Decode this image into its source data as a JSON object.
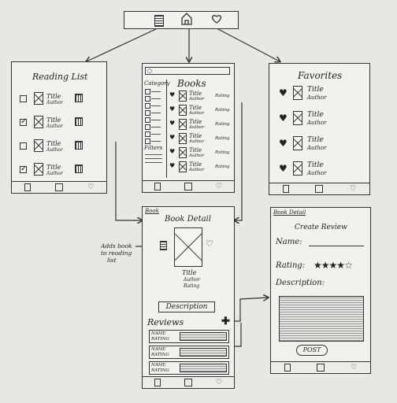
{
  "reading_list": {
    "title": "Reading List",
    "items": [
      {
        "title": "Title",
        "author": "Author",
        "checked": false
      },
      {
        "title": "Title",
        "author": "Author",
        "checked": true
      },
      {
        "title": "Title",
        "author": "Author",
        "checked": false
      },
      {
        "title": "Title",
        "author": "Author",
        "checked": true
      }
    ]
  },
  "books": {
    "title": "Books",
    "category_label": "Category",
    "filters_label": "Filters",
    "items": [
      {
        "title": "Title",
        "author": "Author",
        "rating": "Rating"
      },
      {
        "title": "Title",
        "author": "Author",
        "rating": "Rating"
      },
      {
        "title": "Title",
        "author": "Author",
        "rating": "Rating"
      },
      {
        "title": "Title",
        "author": "Author",
        "rating": "Rating"
      },
      {
        "title": "Title",
        "author": "Author",
        "rating": "Rating"
      },
      {
        "title": "Title",
        "author": "Author",
        "rating": "Rating"
      }
    ]
  },
  "favorites": {
    "title": "Favorites",
    "items": [
      {
        "title": "Title",
        "author": "Author"
      },
      {
        "title": "Title",
        "author": "Author"
      },
      {
        "title": "Title",
        "author": "Author"
      },
      {
        "title": "Title",
        "author": "Author"
      }
    ]
  },
  "book_detail": {
    "tab": "Book",
    "title": "Book Detail",
    "book_title": "Title",
    "book_author": "Author",
    "book_rating": "Rating",
    "description_button": "Description",
    "reviews_label": "Reviews",
    "reviews": [
      {
        "name": "NAME",
        "rating": "RATING"
      },
      {
        "name": "NAME",
        "rating": "RATING"
      },
      {
        "name": "NAME",
        "rating": "RATING"
      }
    ]
  },
  "annotation": {
    "line1": "Adds book",
    "line2": "to reading",
    "line3": "list"
  },
  "create_review": {
    "tab": "Book Detail",
    "title": "Create Review",
    "name_label": "Name:",
    "rating_label": "Rating:",
    "description_label": "Description:",
    "post_button": "POST"
  },
  "icons": [
    "list-icon",
    "home-icon",
    "heart-icon",
    "trash-icon",
    "search-icon",
    "plus-icon",
    "book-icon"
  ]
}
